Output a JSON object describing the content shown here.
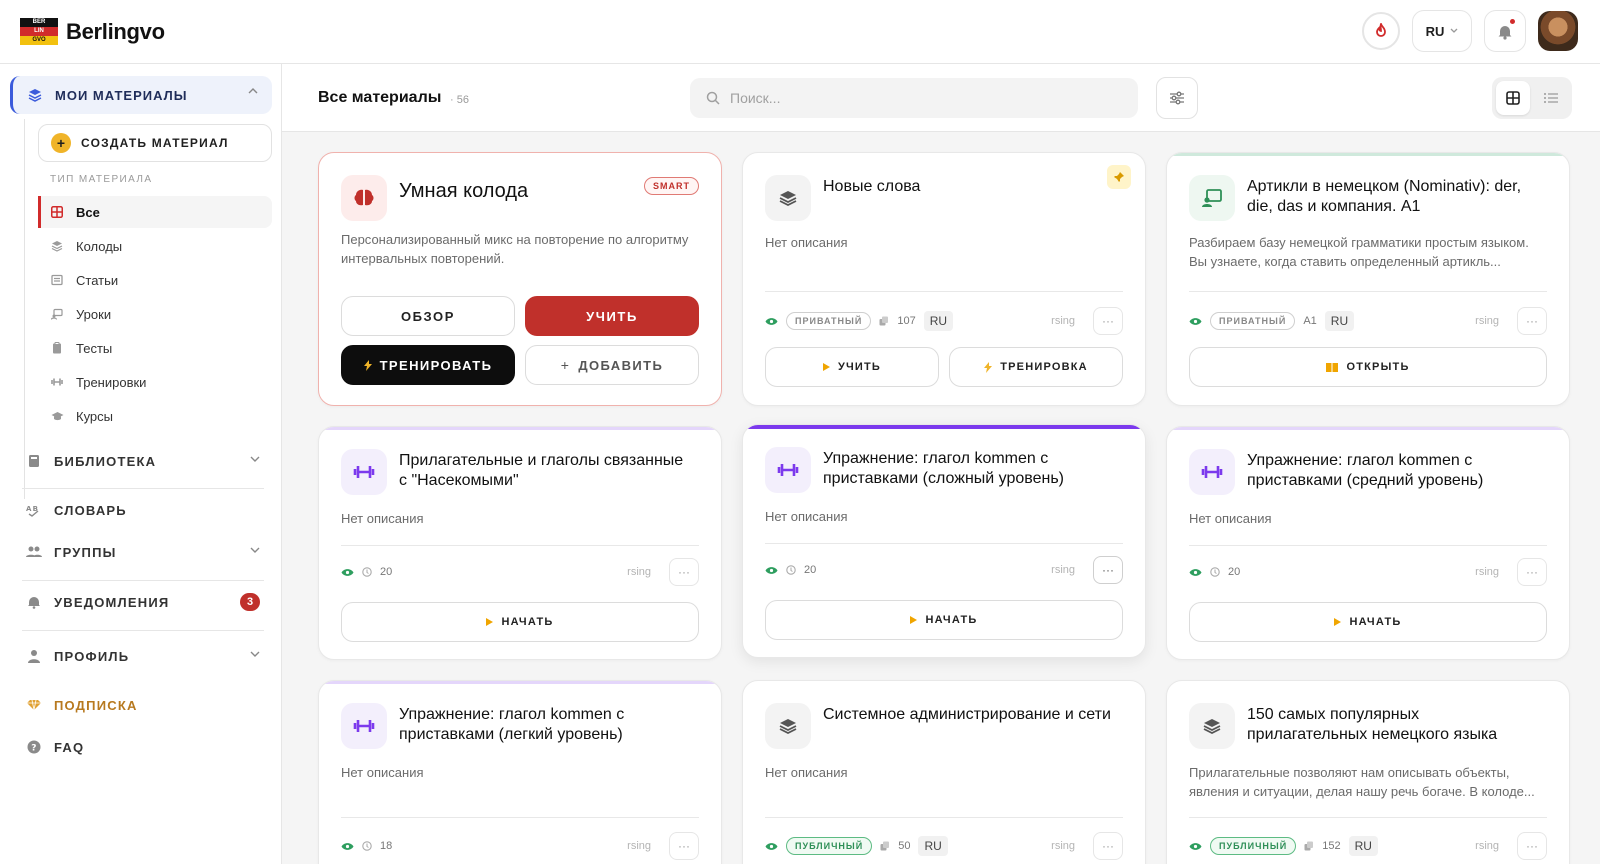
{
  "app": {
    "logo_lines": [
      "BER",
      "LIN",
      "GVO"
    ],
    "brand": "Berlingvo",
    "language": "RU"
  },
  "sidebar": {
    "my_materials": "МОИ МАТЕРИАЛЫ",
    "create_material": "СОЗДАТЬ МАТЕРИАЛ",
    "type_title": "ТИП МАТЕРИАЛА",
    "types": [
      {
        "label": "Все",
        "icon": "grid-icon",
        "active": true
      },
      {
        "label": "Колоды",
        "icon": "layers-icon"
      },
      {
        "label": "Статьи",
        "icon": "article-icon"
      },
      {
        "label": "Уроки",
        "icon": "lesson-icon"
      },
      {
        "label": "Тесты",
        "icon": "clipboard-icon"
      },
      {
        "label": "Тренировки",
        "icon": "dumbbell-icon"
      },
      {
        "label": "Курсы",
        "icon": "graduation-cap-icon"
      }
    ],
    "library": "БИБЛИОТЕКА",
    "dictionary": "СЛОВАРЬ",
    "groups": "ГРУППЫ",
    "notifications": "УВЕДОМЛЕНИЯ",
    "notifications_count": "3",
    "profile": "ПРОФИЛЬ",
    "subscription": "ПОДПИСКА",
    "faq": "FAQ"
  },
  "header": {
    "title": "Все материалы",
    "count": "· 56",
    "search_placeholder": "Поиск..."
  },
  "smart_card": {
    "title": "Умная колода",
    "badge": "SMART",
    "description": "Персонализированный микс на повторение по алгоритму интервальных повторений.",
    "btn_overview": "ОБЗОР",
    "btn_learn": "УЧИТЬ",
    "btn_train": "ТРЕНИРОВАТЬ",
    "btn_add": "ДОБАВИТЬ"
  },
  "cards": [
    {
      "title": "Новые слова",
      "description": "Нет описания",
      "status": "ПРИВАТНЫЙ",
      "count": "107",
      "lang": "RU",
      "author": "rsing",
      "buttons": [
        "УЧИТЬ",
        "ТРЕНИРОВКА"
      ]
    },
    {
      "title": "Артикли в немецком (Nominativ): der, die, das и компания. A1",
      "description": "Разбираем базу немецкой грамматики простым языком. Вы узнаете, когда ставить определенный артикль...",
      "status": "ПРИВАТНЫЙ",
      "level": "A1",
      "lang": "RU",
      "author": "rsing",
      "buttons": [
        "ОТКРЫТЬ"
      ]
    },
    {
      "title": "Прилагательные и глаголы связанные с \"Насекомыми\"",
      "description": "Нет описания",
      "count": "20",
      "author": "rsing",
      "buttons": [
        "НАЧАТЬ"
      ]
    },
    {
      "title": "Упражнение: глагол kommen с приставками (сложный уровень)",
      "description": "Нет описания",
      "count": "20",
      "author": "rsing",
      "buttons": [
        "НАЧАТЬ"
      ]
    },
    {
      "title": "Упражнение: глагол kommen с приставками (средний уровень)",
      "description": "Нет описания",
      "count": "20",
      "author": "rsing",
      "buttons": [
        "НАЧАТЬ"
      ]
    },
    {
      "title": "Упражнение: глагол kommen с приставками (легкий уровень)",
      "description": "Нет описания",
      "count": "18",
      "author": "rsing"
    },
    {
      "title": "Системное администрирование и сети",
      "description": "Нет описания",
      "status": "ПУБЛИЧНЫЙ",
      "count": "50",
      "lang": "RU",
      "author": "rsing"
    },
    {
      "title": "150 самых популярных прилагательных немецкого языка",
      "description": "Прилагательные позволяют нам описывать объекты, явления и ситуации, делая нашу речь богаче. В колоде...",
      "status": "ПУБЛИЧНЫЙ",
      "count": "152",
      "lang": "RU",
      "author": "rsing"
    }
  ],
  "colors": {
    "accent_red": "#c0302b",
    "accent_blue": "#3b5bdb",
    "purple": "#7c3aed",
    "green": "#2e8f57",
    "yellow": "#f0a500"
  }
}
